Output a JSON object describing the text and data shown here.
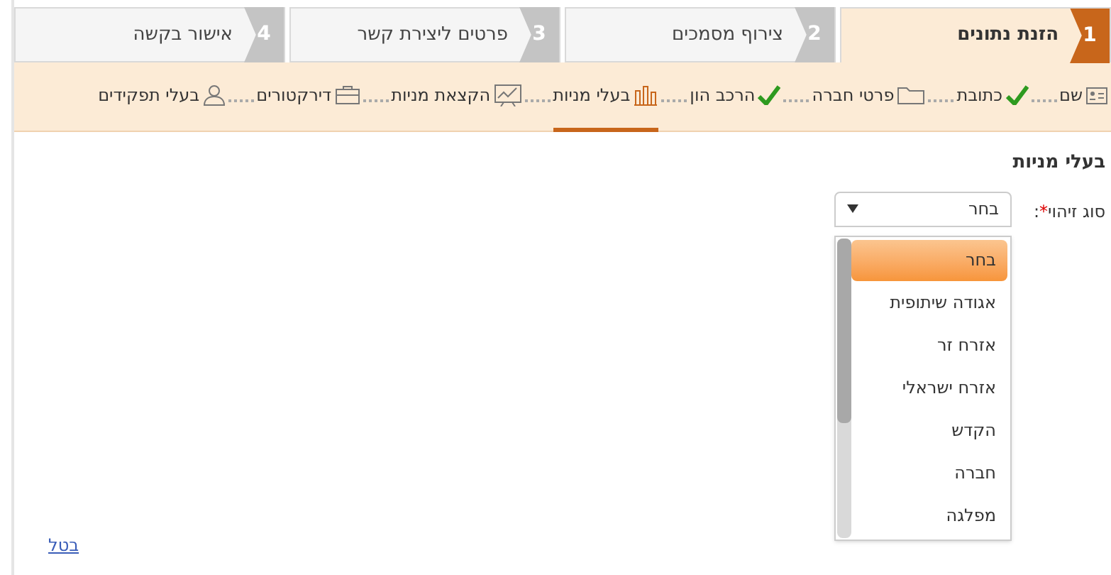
{
  "steps": [
    {
      "number": "1",
      "label": "הזנת נתונים",
      "selected": true
    },
    {
      "number": "2",
      "label": "צירוף מסמכים",
      "selected": false
    },
    {
      "number": "3",
      "label": "פרטים ליצירת קשר",
      "selected": false
    },
    {
      "number": "4",
      "label": "אישור בקשה",
      "selected": false
    }
  ],
  "substeps": [
    {
      "label": "שם",
      "done": false,
      "selected": false
    },
    {
      "label": "כתובת",
      "done": true,
      "selected": false
    },
    {
      "label": "פרטי חברה",
      "done": false,
      "selected": false
    },
    {
      "label": "הרכב הון",
      "done": true,
      "selected": false
    },
    {
      "label": "בעלי מניות",
      "done": false,
      "selected": true
    },
    {
      "label": "הקצאת מניות",
      "done": false,
      "selected": false
    },
    {
      "label": "דירקטורים",
      "done": false,
      "selected": false
    },
    {
      "label": "בעלי תפקידים",
      "done": false,
      "selected": false
    }
  ],
  "section_title": "בעלי מניות",
  "id_type": {
    "label": "סוג זיהוי",
    "required_mark": "*",
    "colon": ":",
    "value": "בחר",
    "expanded": true,
    "options": [
      {
        "label": "בחר",
        "selected": true
      },
      {
        "label": "אגודה שיתופית",
        "selected": false
      },
      {
        "label": "אזרח זר",
        "selected": false
      },
      {
        "label": "אזרח ישראלי",
        "selected": false
      },
      {
        "label": "הקדש",
        "selected": false
      },
      {
        "label": "חברה",
        "selected": false
      },
      {
        "label": "מפלגה",
        "selected": false
      }
    ]
  },
  "cancel_link": "בטל"
}
